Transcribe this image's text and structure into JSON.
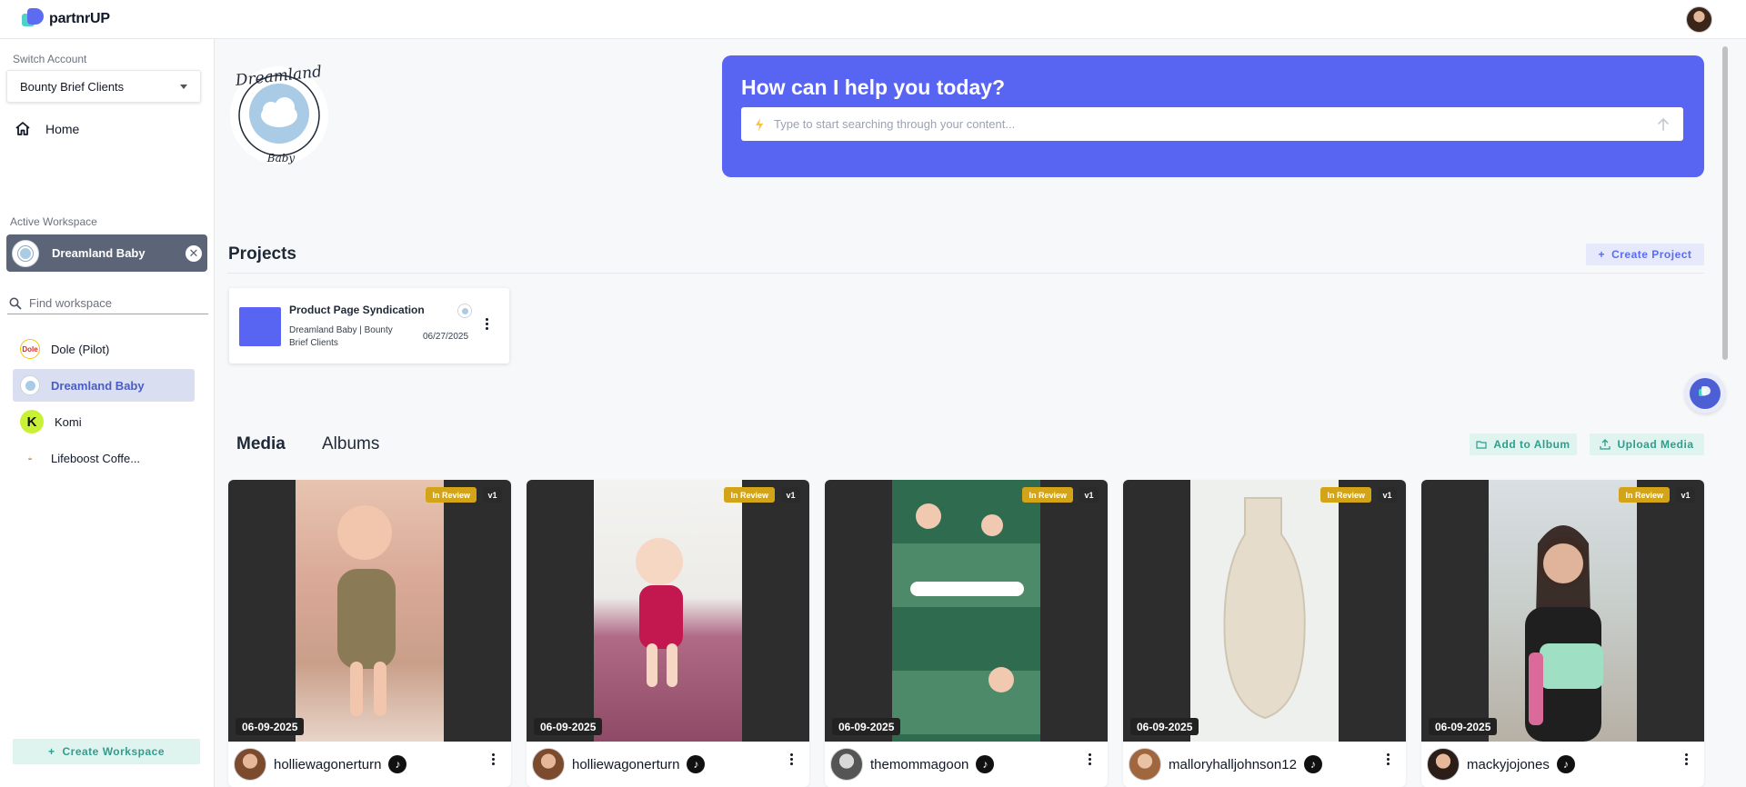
{
  "app": {
    "name": "partnrUP"
  },
  "sidebar": {
    "switch_account_label": "Switch Account",
    "account_selected": "Bounty Brief Clients",
    "home_label": "Home",
    "active_workspace_label": "Active Workspace",
    "active_workspace_name": "Dreamland Baby",
    "find_placeholder": "Find workspace",
    "workspaces": [
      {
        "name": "Dole (Pilot)",
        "icon": "dole-logo"
      },
      {
        "name": "Dreamland Baby",
        "icon": "dreamland-logo",
        "selected": true
      },
      {
        "name": "Komi",
        "icon": "komi-logo",
        "letter": "K"
      },
      {
        "name": "Lifeboost Coffe...",
        "icon": "lifeboost-logo"
      }
    ],
    "create_workspace_label": "Create Workspace"
  },
  "brand": {
    "logo_text_top": "Dreamland",
    "logo_text_bottom": "Baby"
  },
  "hero": {
    "title": "How can I help you today?",
    "search_placeholder": "Type to start searching through your content..."
  },
  "projects": {
    "title": "Projects",
    "create_label": "Create Project",
    "items": [
      {
        "name": "Product Page Syndication",
        "client": "Dreamland Baby | Bounty Brief Clients",
        "date": "06/27/2025",
        "color": "#5865f2"
      }
    ]
  },
  "media_section": {
    "tabs": [
      "Media",
      "Albums"
    ],
    "add_to_album_label": "Add to Album",
    "upload_media_label": "Upload Media",
    "items": [
      {
        "status": "In Review",
        "version": "v1",
        "date": "06-09-2025",
        "creator": "holliewagonerturn",
        "platform": "tiktok"
      },
      {
        "status": "In Review",
        "version": "v1",
        "date": "06-09-2025",
        "creator": "holliewagonerturn",
        "platform": "tiktok"
      },
      {
        "status": "In Review",
        "version": "v1",
        "date": "06-09-2025",
        "creator": "themommagoon",
        "platform": "tiktok"
      },
      {
        "status": "In Review",
        "version": "v1",
        "date": "06-09-2025",
        "creator": "malloryhalljohnson12",
        "platform": "tiktok"
      },
      {
        "status": "In Review",
        "version": "v1",
        "date": "06-09-2025",
        "creator": "mackyjojones",
        "platform": "tiktok"
      }
    ]
  },
  "colors": {
    "accent": "#5865f2",
    "teal": "#2f9e8f",
    "review_badge": "#d4a418"
  }
}
